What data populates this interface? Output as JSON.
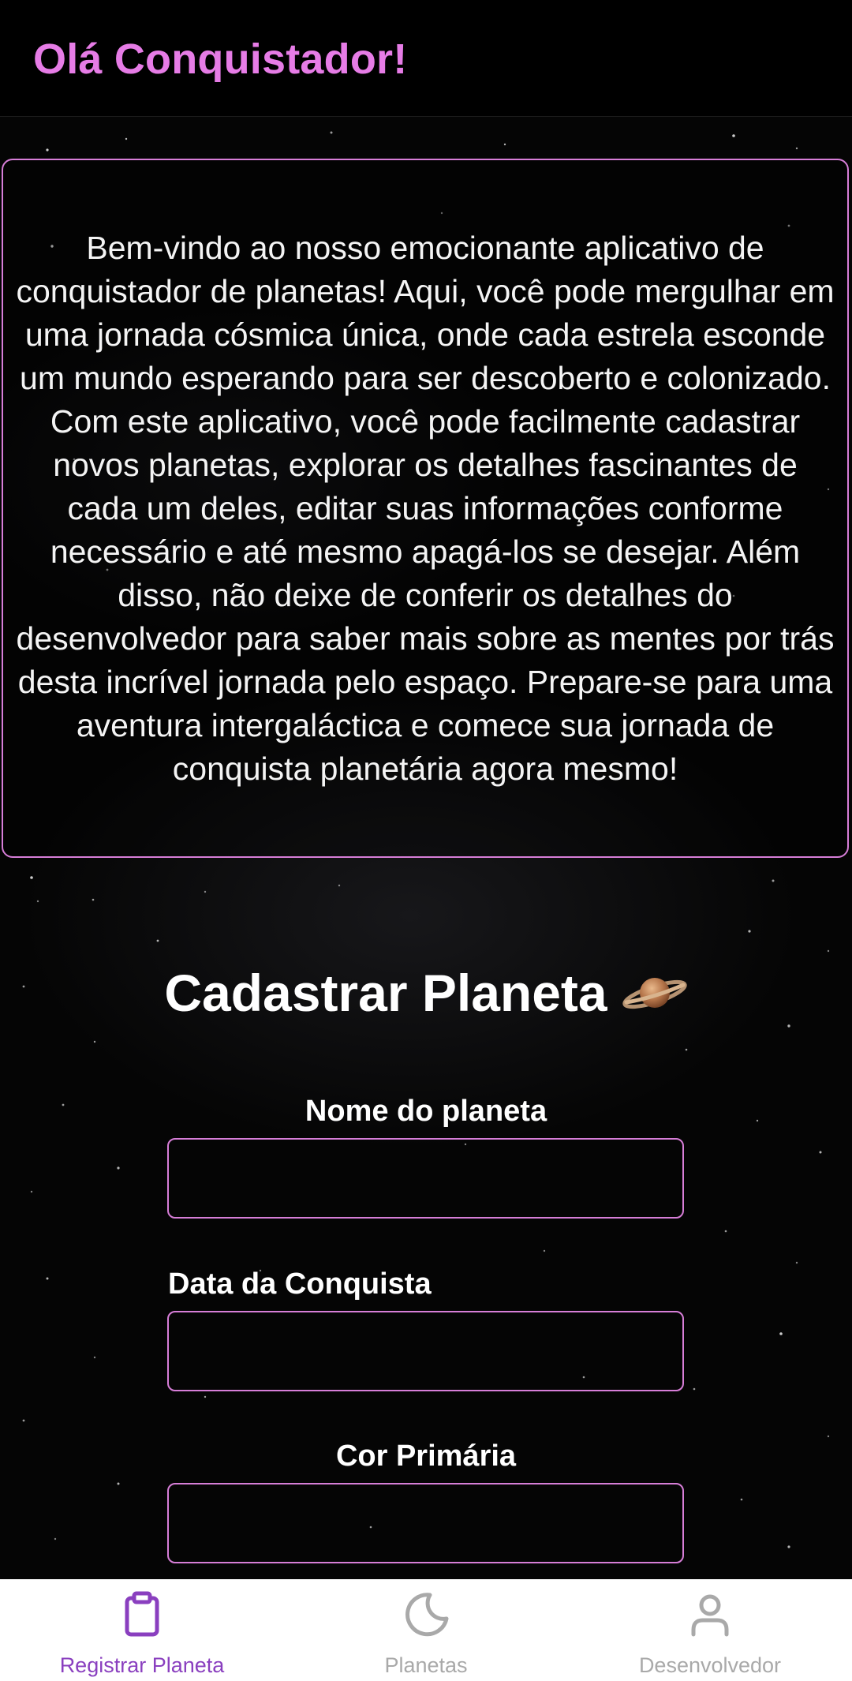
{
  "header": {
    "title": "Olá Conquistador!"
  },
  "intro": {
    "text": "Bem-vindo ao nosso emocionante aplicativo de conquistador de planetas! Aqui, você pode mergulhar em uma jornada cósmica única, onde cada estrela esconde um mundo esperando para ser descoberto e colonizado. Com este aplicativo, você pode facilmente cadastrar novos planetas, explorar os detalhes fascinantes de cada um deles, editar suas informações conforme necessário e até mesmo apagá-los se desejar. Além disso, não deixe de conferir os detalhes do desenvolvedor para saber mais sobre as mentes por trás desta incrível jornada pelo espaço. Prepare-se para uma aventura intergaláctica e comece sua jornada de conquista planetária agora mesmo!"
  },
  "form": {
    "title": "Cadastrar Planeta",
    "title_icon": "ringed-planet-icon",
    "fields": [
      {
        "label": "Nome do planeta",
        "value": "",
        "placeholder": ""
      },
      {
        "label": "Data da Conquista",
        "value": "",
        "placeholder": ""
      },
      {
        "label": "Cor Primária",
        "value": "",
        "placeholder": ""
      }
    ]
  },
  "nav": {
    "items": [
      {
        "label": "Registrar Planeta",
        "icon": "clipboard-icon",
        "active": true
      },
      {
        "label": "Planetas",
        "icon": "moon-icon",
        "active": false
      },
      {
        "label": "Desenvolvedor",
        "icon": "person-icon",
        "active": false
      }
    ]
  },
  "colors": {
    "accent": "#e67ce6",
    "border": "#d77ed8",
    "nav_active": "#8a3fbf",
    "nav_inactive": "#a9a9a9",
    "background": "#000000"
  }
}
